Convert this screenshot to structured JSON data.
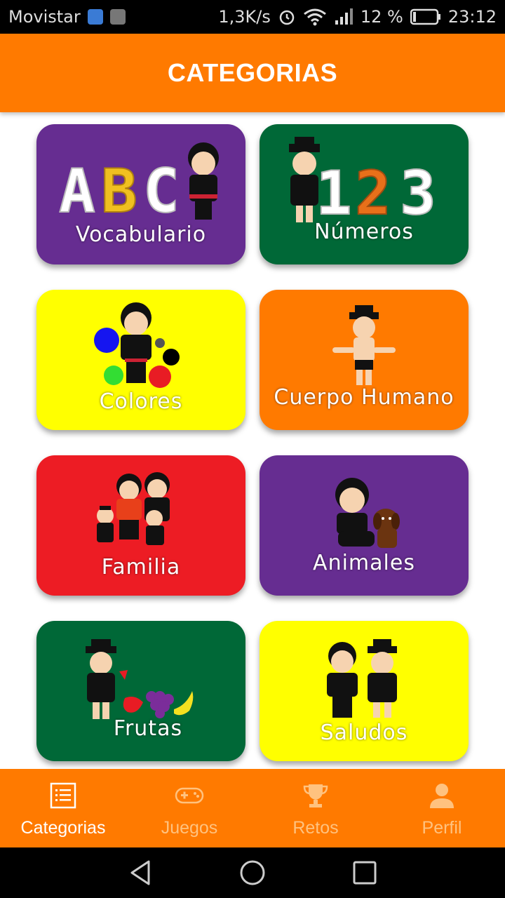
{
  "status_bar": {
    "carrier": "Movistar",
    "speed": "1,3K/s",
    "battery": "12 %",
    "time": "23:12"
  },
  "header": {
    "title": "CATEGORIAS"
  },
  "categories": [
    {
      "label": "Vocabulario",
      "color": "#662d91",
      "image": "abc-girl"
    },
    {
      "label": "Números",
      "color": "#006837",
      "image": "123-boy"
    },
    {
      "label": "Colores",
      "color": "#ffff00",
      "image": "girl-color-circles"
    },
    {
      "label": "Cuerpo Humano",
      "color": "#ff7a00",
      "image": "boy-body"
    },
    {
      "label": "Familia",
      "color": "#ed1c24",
      "image": "family"
    },
    {
      "label": "Animales",
      "color": "#662d91",
      "image": "girl-dog"
    },
    {
      "label": "Frutas",
      "color": "#006837",
      "image": "boy-fruits"
    },
    {
      "label": "Saludos",
      "color": "#ffff00",
      "image": "greeting-couple"
    }
  ],
  "bottom_nav": {
    "items": [
      {
        "label": "Categorias",
        "icon": "list-icon",
        "active": true
      },
      {
        "label": "Juegos",
        "icon": "gamepad-icon",
        "active": false
      },
      {
        "label": "Retos",
        "icon": "trophy-icon",
        "active": false
      },
      {
        "label": "Perfil",
        "icon": "person-icon",
        "active": false
      }
    ]
  },
  "colors": {
    "accent": "#ff7a00"
  }
}
